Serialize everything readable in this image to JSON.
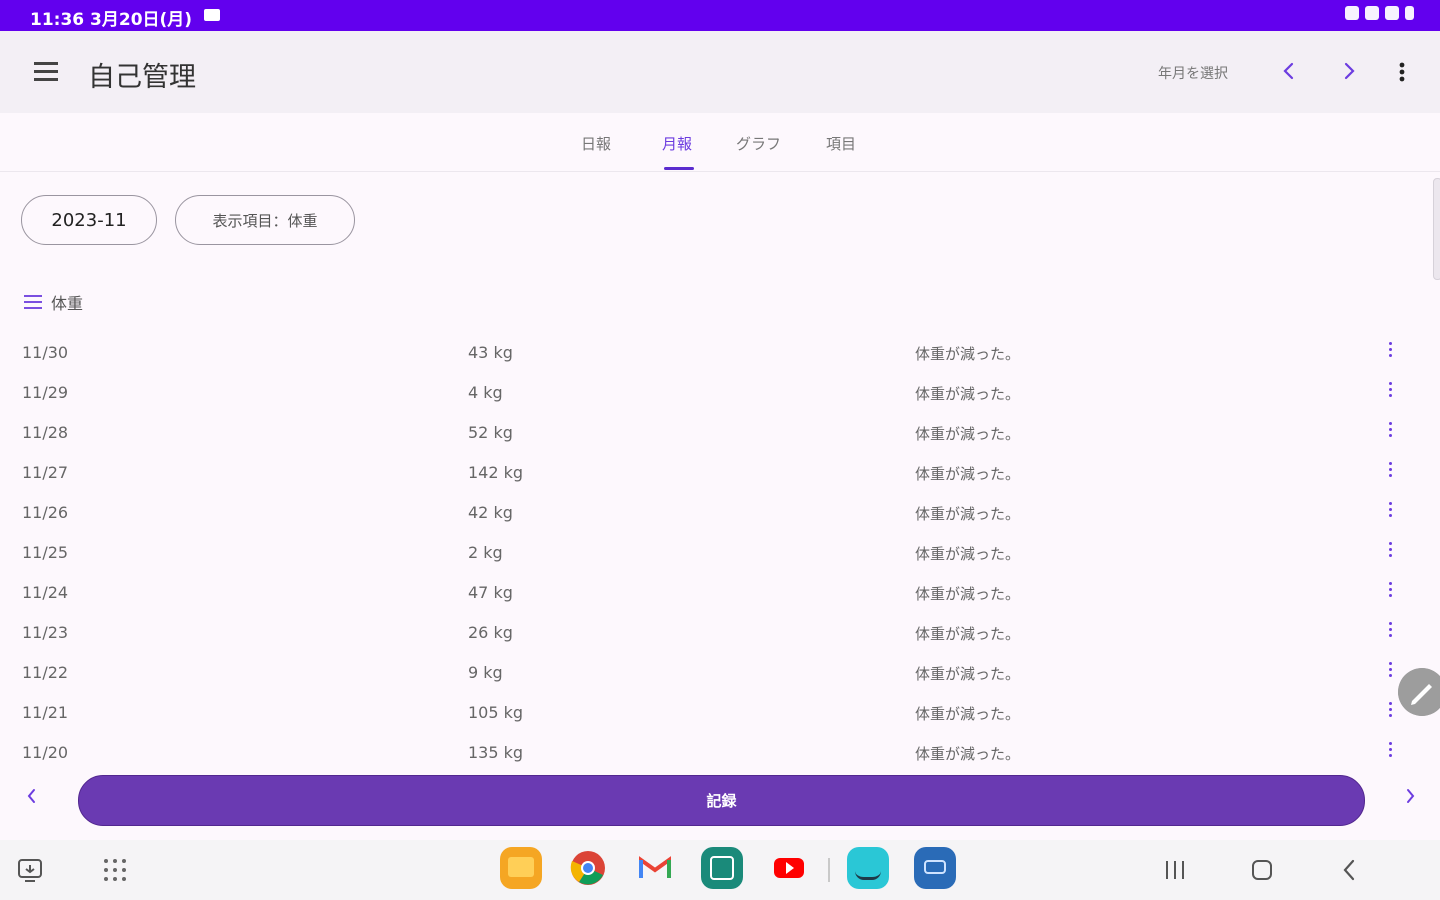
{
  "status_bar": {
    "time_date": "11:36  3月20日(月)"
  },
  "app_bar": {
    "title": "自己管理",
    "select_month": "年月を選択"
  },
  "tabs": [
    {
      "label": "日報",
      "active": false
    },
    {
      "label": "月報",
      "active": true
    },
    {
      "label": "グラフ",
      "active": false
    },
    {
      "label": "項目",
      "active": false
    }
  ],
  "filters": {
    "month": "2023-11",
    "display_item": "表示項目：体重"
  },
  "section": {
    "label": "体重"
  },
  "rows": [
    {
      "date": "11/30",
      "value": "43 kg",
      "note": "体重が減った。"
    },
    {
      "date": "11/29",
      "value": "4 kg",
      "note": "体重が減った。"
    },
    {
      "date": "11/28",
      "value": "52 kg",
      "note": "体重が減った。"
    },
    {
      "date": "11/27",
      "value": "142 kg",
      "note": "体重が減った。"
    },
    {
      "date": "11/26",
      "value": "42 kg",
      "note": "体重が減った。"
    },
    {
      "date": "11/25",
      "value": "2 kg",
      "note": "体重が減った。"
    },
    {
      "date": "11/24",
      "value": "47 kg",
      "note": "体重が減った。"
    },
    {
      "date": "11/23",
      "value": "26 kg",
      "note": "体重が減った。"
    },
    {
      "date": "11/22",
      "value": "9 kg",
      "note": "体重が減った。"
    },
    {
      "date": "11/21",
      "value": "105 kg",
      "note": "体重が減った。"
    },
    {
      "date": "11/20",
      "value": "135 kg",
      "note": "体重が減った。"
    }
  ],
  "record_button": "記録",
  "colors": {
    "status_bar": "#6200ee",
    "accent": "#6c3ce0",
    "record_button": "#6a3ab2",
    "app_bar": "#f3eff5"
  },
  "dock_apps": [
    {
      "icon": "files-app-icon",
      "color": "#f5a623"
    },
    {
      "icon": "chrome-app-icon",
      "color": "#ffffff"
    },
    {
      "icon": "gmail-app-icon",
      "color": "#ffffff"
    },
    {
      "icon": "calendar-app-icon",
      "color": "#1a8a7a"
    },
    {
      "icon": "youtube-app-icon",
      "color": "#ffffff"
    },
    {
      "icon": "amazon-app-icon",
      "color": "#2ac7d6"
    },
    {
      "icon": "prime-video-app-icon",
      "color": "#2a6bb7"
    }
  ]
}
